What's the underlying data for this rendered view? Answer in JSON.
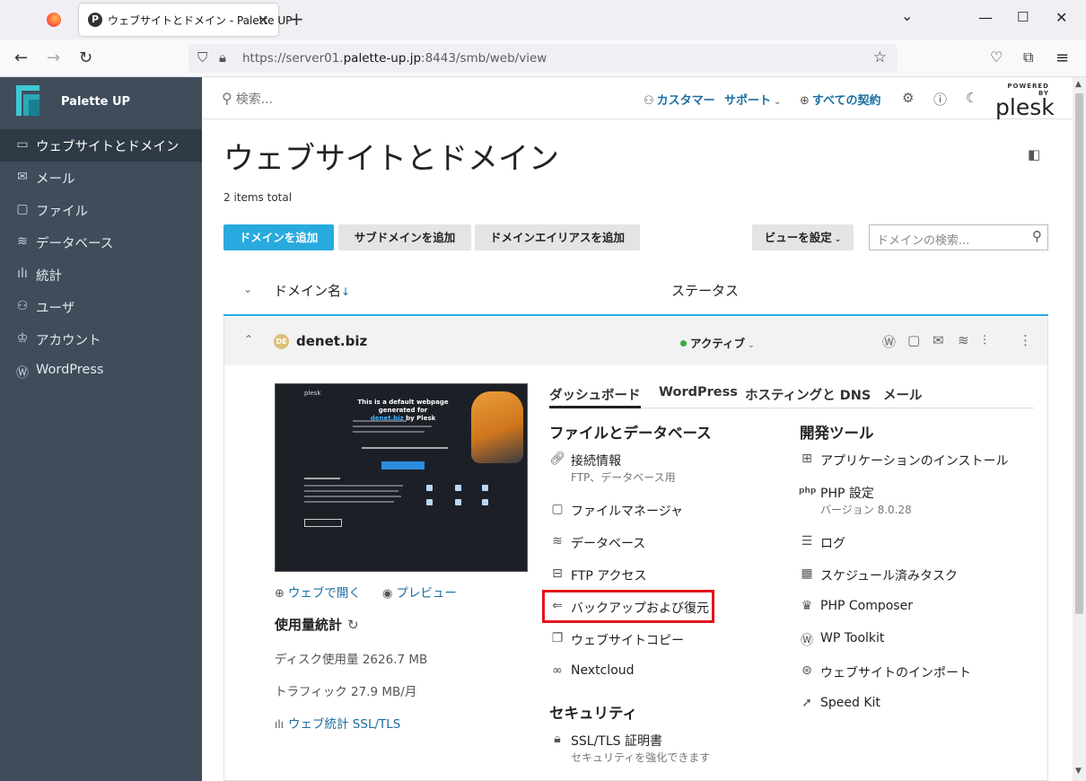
{
  "browser": {
    "tab_title": "ウェブサイトとドメイン - Palette UP",
    "favicon_letter": "P",
    "url_prefix": "https://server01.",
    "url_domain": "palette-up.jp",
    "url_suffix": ":8443/smb/web/view"
  },
  "sidebar": {
    "brand": "Palette UP",
    "items": [
      {
        "label": "ウェブサイトとドメイン",
        "icon": "monitor-icon"
      },
      {
        "label": "メール",
        "icon": "mail-icon"
      },
      {
        "label": "ファイル",
        "icon": "folder-icon"
      },
      {
        "label": "データベース",
        "icon": "database-icon"
      },
      {
        "label": "統計",
        "icon": "stats-icon"
      },
      {
        "label": "ユーザ",
        "icon": "user-icon"
      },
      {
        "label": "アカウント",
        "icon": "account-icon"
      },
      {
        "label": "WordPress",
        "icon": "wordpress-icon"
      }
    ]
  },
  "header": {
    "search_placeholder": "検索...",
    "customer": "カスタマー",
    "support": "サポート",
    "subscriptions": "すべての契約",
    "powered_by": "POWERED BY",
    "plesk": "plesk"
  },
  "page": {
    "title": "ウェブサイトとドメイン",
    "total": "2 items total",
    "buttons": {
      "add_domain": "ドメインを追加",
      "add_subdomain": "サブドメインを追加",
      "add_alias": "ドメインエイリアスを追加",
      "view": "ビューを設定"
    },
    "domain_search_placeholder": "ドメインの検索...",
    "columns": {
      "name": "ドメイン名",
      "sort_arrow": "↓",
      "status": "ステータス"
    }
  },
  "domain": {
    "badge": "DE",
    "name": "denet.biz",
    "status": "アクティブ",
    "preview_site": {
      "brand": "plesk",
      "headline_1": "This is a default webpage generated for",
      "headline_domain": "denet.biz",
      "headline_2": " by Plesk"
    },
    "open_web": "ウェブで開く",
    "preview": "プレビュー",
    "usage_title": "使用量統計",
    "disk": "ディスク使用量 2626.7 MB",
    "traffic": "トラフィック 27.9 MB/月",
    "web_stats": "ウェブ統計 SSL/TLS"
  },
  "tabs": [
    "ダッシュボード",
    "WordPress",
    "ホスティングと DNS",
    "メール"
  ],
  "files_section": {
    "title": "ファイルとデータベース",
    "items": [
      {
        "label": "接続情報",
        "sub": "FTP、データベース用"
      },
      {
        "label": "ファイルマネージャ"
      },
      {
        "label": "データベース"
      },
      {
        "label": "FTP アクセス"
      },
      {
        "label": "バックアップおよび復元"
      },
      {
        "label": "ウェブサイトコピー"
      },
      {
        "label": "Nextcloud"
      }
    ]
  },
  "security_section": {
    "title": "セキュリティ",
    "items": [
      {
        "label": "SSL/TLS 証明書",
        "sub": "セキュリティを強化できます"
      }
    ]
  },
  "dev_section": {
    "title": "開発ツール",
    "items": [
      {
        "label": "アプリケーションのインストール"
      },
      {
        "label": "PHP 設定",
        "sub": "バージョン 8.0.28"
      },
      {
        "label": "ログ"
      },
      {
        "label": "スケジュール済みタスク"
      },
      {
        "label": "PHP Composer"
      },
      {
        "label": "WP Toolkit"
      },
      {
        "label": "ウェブサイトのインポート"
      },
      {
        "label": "Speed Kit"
      }
    ]
  },
  "colors": {
    "accent": "#28aade",
    "link": "#1a6ea1",
    "sidebar": "#3f4d5b",
    "highlight": "#e4141b",
    "active": "#3cab3c"
  }
}
